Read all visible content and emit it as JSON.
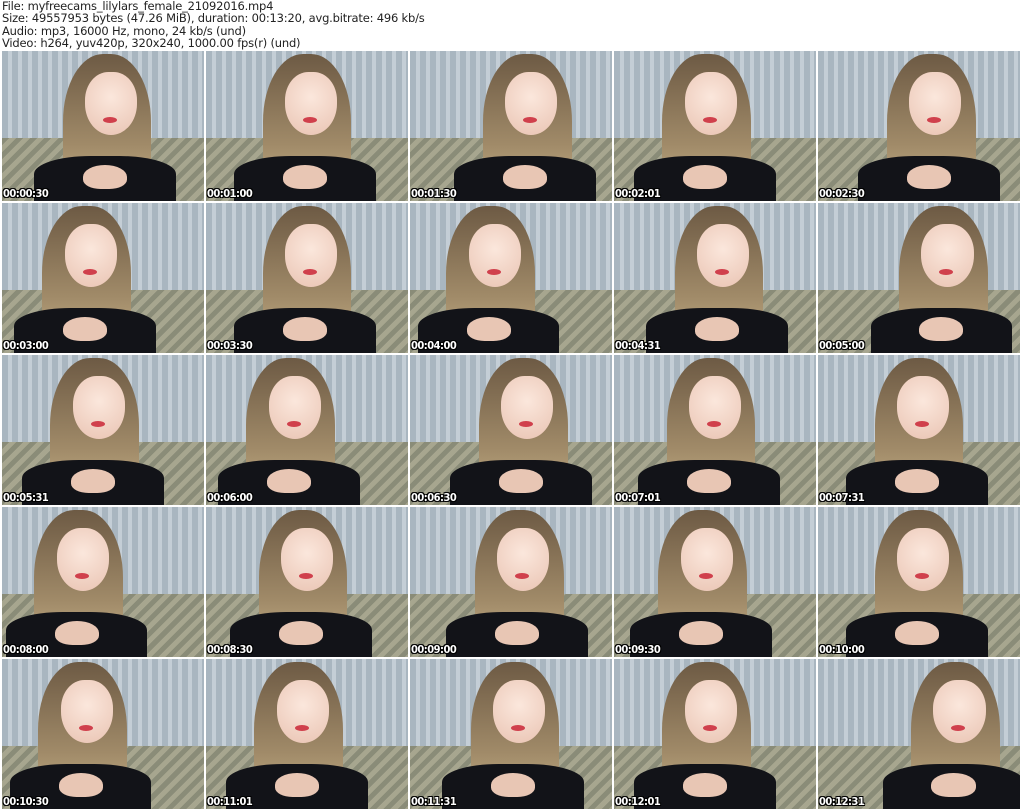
{
  "header": {
    "file": "File: myfreecams_lilylars_female_21092016.mp4",
    "size": "Size: 49557953 bytes (47.26 MiB), duration: 00:13:20, avg.bitrate: 496 kb/s",
    "audio": "Audio: mp3, 16000 Hz, mono, 24 kb/s (und)",
    "video": "Video: h264, yuv420p, 320x240, 1000.00 fps(r) (und)"
  },
  "thumbnails": [
    "00:00:30",
    "00:01:00",
    "00:01:30",
    "00:02:01",
    "00:02:30",
    "00:03:00",
    "00:03:30",
    "00:04:00",
    "00:04:31",
    "00:05:00",
    "00:05:31",
    "00:06:00",
    "00:06:30",
    "00:07:01",
    "00:07:31",
    "00:08:00",
    "00:08:30",
    "00:09:00",
    "00:09:30",
    "00:10:00",
    "00:10:30",
    "00:11:01",
    "00:11:31",
    "00:12:01",
    "00:12:31"
  ]
}
